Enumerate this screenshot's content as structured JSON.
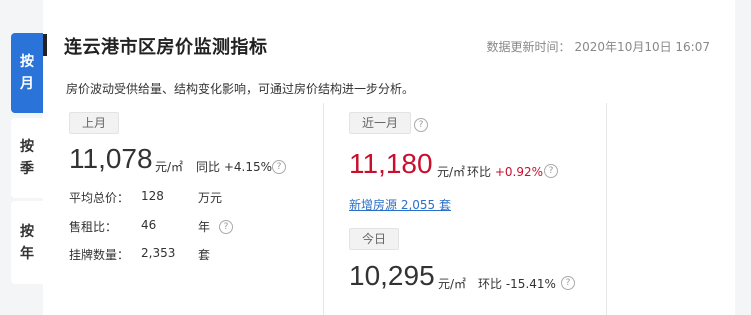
{
  "tabs": [
    {
      "label_1": "按",
      "label_2": "月",
      "active": true
    },
    {
      "label_1": "按",
      "label_2": "季",
      "active": false
    },
    {
      "label_1": "按",
      "label_2": "年",
      "active": false
    }
  ],
  "header": {
    "title": "连云港市区房价监测指标",
    "update_label": "数据更新时间：",
    "update_time": "2020年10月10日 16:07"
  },
  "description": "房价波动受供给量、结构变化影响，可通过房价结构进一步分析。",
  "last_month": {
    "pill": "上月",
    "price": "11,078",
    "unit": "元/㎡",
    "compare_label": "同比",
    "compare_value": "+4.15%",
    "rows": [
      {
        "label": "平均总价：",
        "value": "128",
        "unit": "万元"
      },
      {
        "label": "售租比：",
        "value": "46",
        "unit": "年"
      },
      {
        "label": "挂牌数量：",
        "value": "2,353",
        "unit": "套"
      }
    ]
  },
  "recent_month": {
    "pill": "近一月",
    "price": "11,180",
    "unit": "元/㎡",
    "compare_label": "环比",
    "compare_value": "+0.92%",
    "new_listings": "新增房源 2,055 套"
  },
  "today": {
    "pill": "今日",
    "price": "10,295",
    "unit": "元/㎡",
    "compare_label": "环比",
    "compare_value": "-15.41%"
  },
  "icons": {
    "help": "?"
  },
  "colors": {
    "accent_blue": "#2a74d9",
    "red": "#c8102e",
    "link_blue": "#2a6fc9"
  }
}
